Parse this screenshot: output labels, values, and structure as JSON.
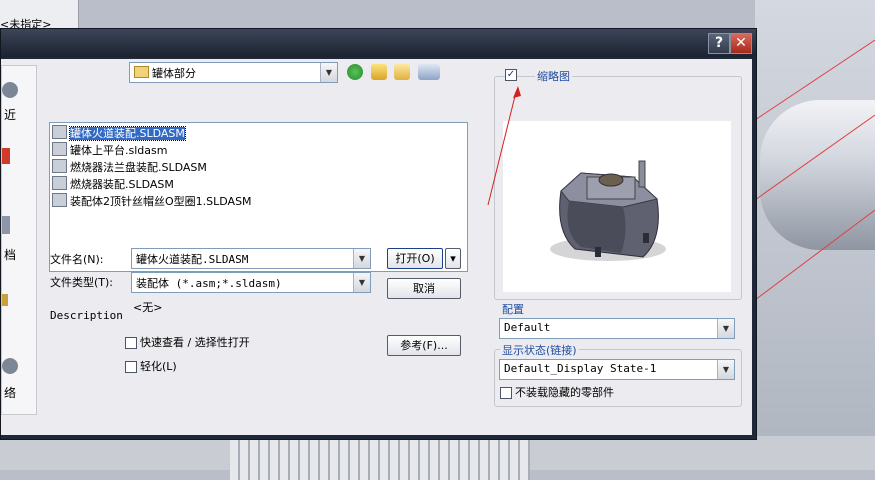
{
  "background": {
    "panel_text": "<未指定>",
    "places": [
      "近",
      "档",
      "络"
    ]
  },
  "dialog": {
    "help_button": "?",
    "close_button": "✕"
  },
  "toolbar": {
    "folder": "罐体部分"
  },
  "files": [
    {
      "name": "罐体火道装配.SLDASM",
      "selected": true
    },
    {
      "name": "罐体上平台.sldasm",
      "selected": false
    },
    {
      "name": "燃烧器法兰盘装配.SLDASM",
      "selected": false
    },
    {
      "name": "燃烧器装配.SLDASM",
      "selected": false
    },
    {
      "name": "装配体2顶针丝帽丝O型圈1.SLDASM",
      "selected": false
    }
  ],
  "form": {
    "filename_label": "文件名(N):",
    "filename_value": "罐体火道装配.SLDASM",
    "filetype_label": "文件类型(T):",
    "filetype_value": "装配体 (*.asm;*.sldasm)",
    "none_text": "<无>",
    "description_label": "Description",
    "quick_view_label": "快速查看 / 选择性打开",
    "lightweight_label": "轻化(L)",
    "open_button": "打开(O)",
    "cancel_button": "取消",
    "references_button": "参考(F)..."
  },
  "right_panel": {
    "thumbnail_label": "缩略图",
    "thumbnail_checked": true,
    "config_title": "配置",
    "config_value": "Default",
    "display_title": "显示状态(链接)",
    "display_value": "Default_Display State-1",
    "hidden_parts_label": "不装载隐藏的零部件"
  },
  "colors": {
    "selection": "#316ac5",
    "group_title": "#1e4da1",
    "annotation_arrow": "#d42020"
  }
}
